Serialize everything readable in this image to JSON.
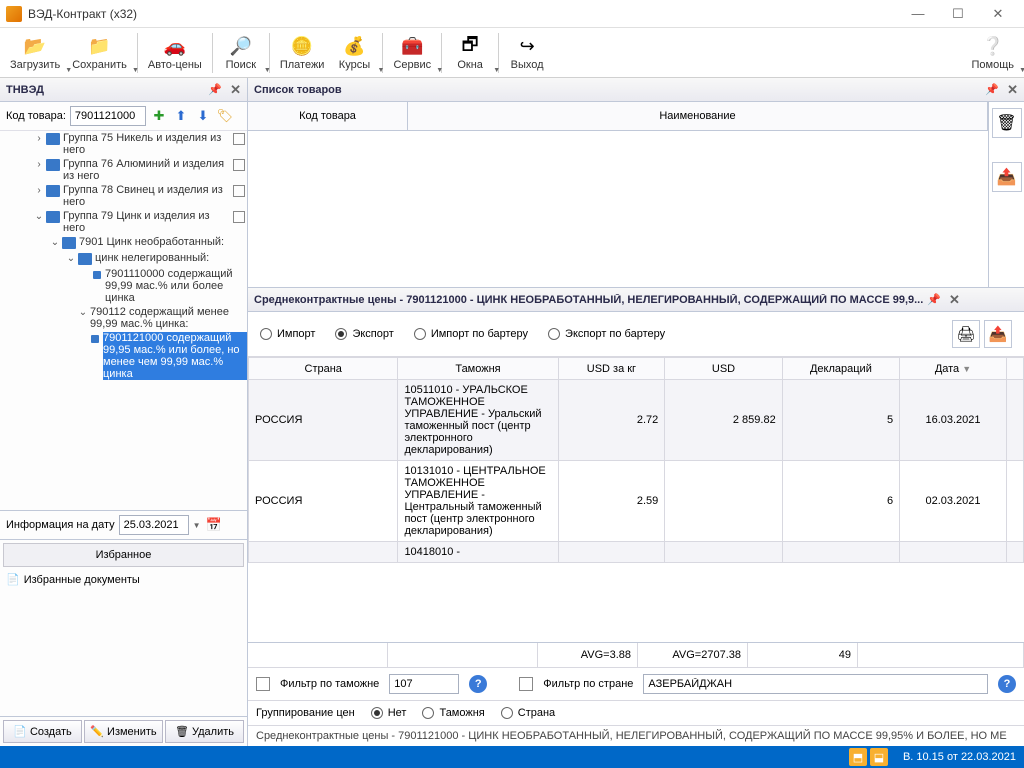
{
  "window": {
    "title": "ВЭД-Контракт (x32)"
  },
  "toolbar": {
    "load": "Загрузить",
    "save": "Сохранить",
    "autoprice": "Авто-цены",
    "search": "Поиск",
    "payments": "Платежи",
    "rates": "Курсы",
    "service": "Сервис",
    "windows": "Окна",
    "exit": "Выход",
    "help": "Помощь"
  },
  "left": {
    "panel_title": "ТНВЭД",
    "code_label": "Код товара:",
    "code_value": "7901121000",
    "tree": {
      "g75": "Группа 75 Никель и изделия из него",
      "g76": "Группа 76 Алюминий и изделия из него",
      "g78": "Группа 78 Свинец и изделия из него",
      "g79": "Группа 79 Цинк и изделия из него",
      "n7901": "7901 Цинк необработанный:",
      "nzinc": "цинк нелегированный:",
      "n79011100": "7901110000 содержащий 99,99 мас.% или более цинка",
      "n790112": "790112 содержащий менее 99,99 мас.% цинка:",
      "sel": "7901121000 содержащий 99,95 мас.% или более, но менее чем 99,99 мас.% цинка"
    },
    "date_label": "Информация на дату",
    "date_value": "25.03.2021",
    "fav_title": "Избранное",
    "fav_docs": "Избранные документы",
    "btn_create": "Создать",
    "btn_edit": "Изменить",
    "btn_delete": "Удалить"
  },
  "goods": {
    "title": "Список товаров",
    "col_code": "Код товара",
    "col_name": "Наименование"
  },
  "prices": {
    "title": "Среднеконтрактные цены - 7901121000 - ЦИНК НЕОБРАБОТАННЫЙ, НЕЛЕГИРОВАННЫЙ, СОДЕРЖАЩИЙ ПО МАССЕ 99,9...",
    "r_import": "Импорт",
    "r_export": "Экспорт",
    "r_imp_b": "Импорт по бартеру",
    "r_exp_b": "Экспорт по бартеру",
    "cols": {
      "country": "Страна",
      "customs": "Таможня",
      "usdkg": "USD за кг",
      "usd": "USD",
      "decl": "Деклараций",
      "date": "Дата"
    },
    "rows": [
      {
        "country": "РОССИЯ",
        "customs": "10511010 - УРАЛЬСКОЕ ТАМОЖЕННОЕ УПРАВЛЕНИЕ - Уральский таможенный пост (центр электронного декларирования)",
        "usdkg": "2.72",
        "usd": "2 859.82",
        "decl": "5",
        "date": "16.03.2021"
      },
      {
        "country": "РОССИЯ",
        "customs": "10131010 - ЦЕНТРАЛЬНОЕ ТАМОЖЕННОЕ УПРАВЛЕНИЕ - Центральный таможенный пост (центр электронного декларирования)",
        "usdkg": "2.59",
        "usd": "",
        "decl": "6",
        "date": "02.03.2021"
      },
      {
        "country": "",
        "customs": "10418010 -",
        "usdkg": "",
        "usd": "",
        "decl": "",
        "date": ""
      }
    ],
    "avg_usdkg": "AVG=3.88",
    "avg_usd": "AVG=2707.38",
    "avg_decl": "49",
    "flt_customs": "Фильтр по таможне",
    "flt_customs_val": "107",
    "flt_country": "Фильтр по стране",
    "flt_country_val": "АЗЕРБАЙДЖАН",
    "grp_label": "Группирование цен",
    "grp_none": "Нет",
    "grp_customs": "Таможня",
    "grp_country": "Страна",
    "status": "Среднеконтрактные цены - 7901121000 - ЦИНК НЕОБРАБОТАННЫЙ, НЕЛЕГИРОВАННЫЙ, СОДЕРЖАЩИЙ ПО МАССЕ 99,95% И БОЛЕЕ, НО МЕ"
  },
  "statusbar": {
    "version": "В. 10.15 от 22.03.2021"
  }
}
